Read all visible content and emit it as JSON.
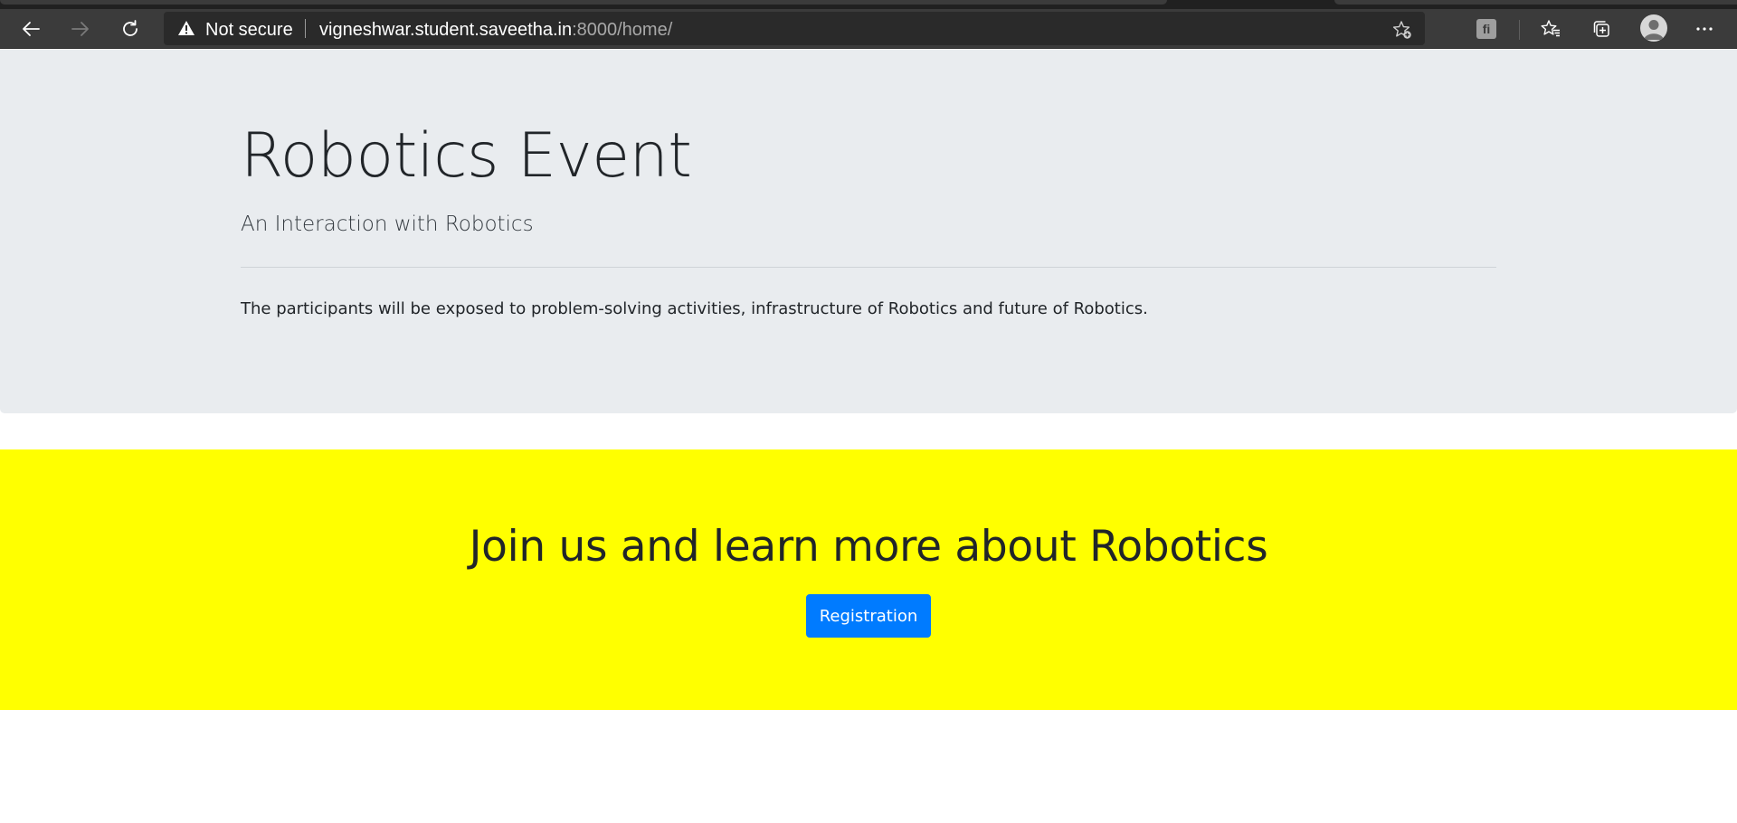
{
  "browser": {
    "security_label": "Not secure",
    "url_host": "vigneshwar.student.saveetha.in",
    "url_rest": ":8000/home/",
    "extension_label": "fi",
    "icons": [
      "back-arrow-icon",
      "forward-arrow-icon",
      "refresh-icon",
      "warning-icon",
      "add-favorite-icon",
      "extension-icon",
      "favorites-icon",
      "collections-icon",
      "profile-avatar-icon",
      "more-menu-icon"
    ]
  },
  "jumbotron": {
    "title": "Robotics Event",
    "subtitle": "An Interaction with Robotics",
    "text": "The participants will be exposed to problem-solving activities, infrastructure of Robotics and future of Robotics."
  },
  "cta": {
    "heading": "Join us and learn more about Robotics",
    "button_label": "Registration"
  },
  "colors": {
    "jumbotron_bg": "#e9ecef",
    "cta_bg": "#ffff00",
    "button_bg": "#007bff",
    "text": "#212529",
    "browser_toolbar": "#3b3b3b"
  }
}
